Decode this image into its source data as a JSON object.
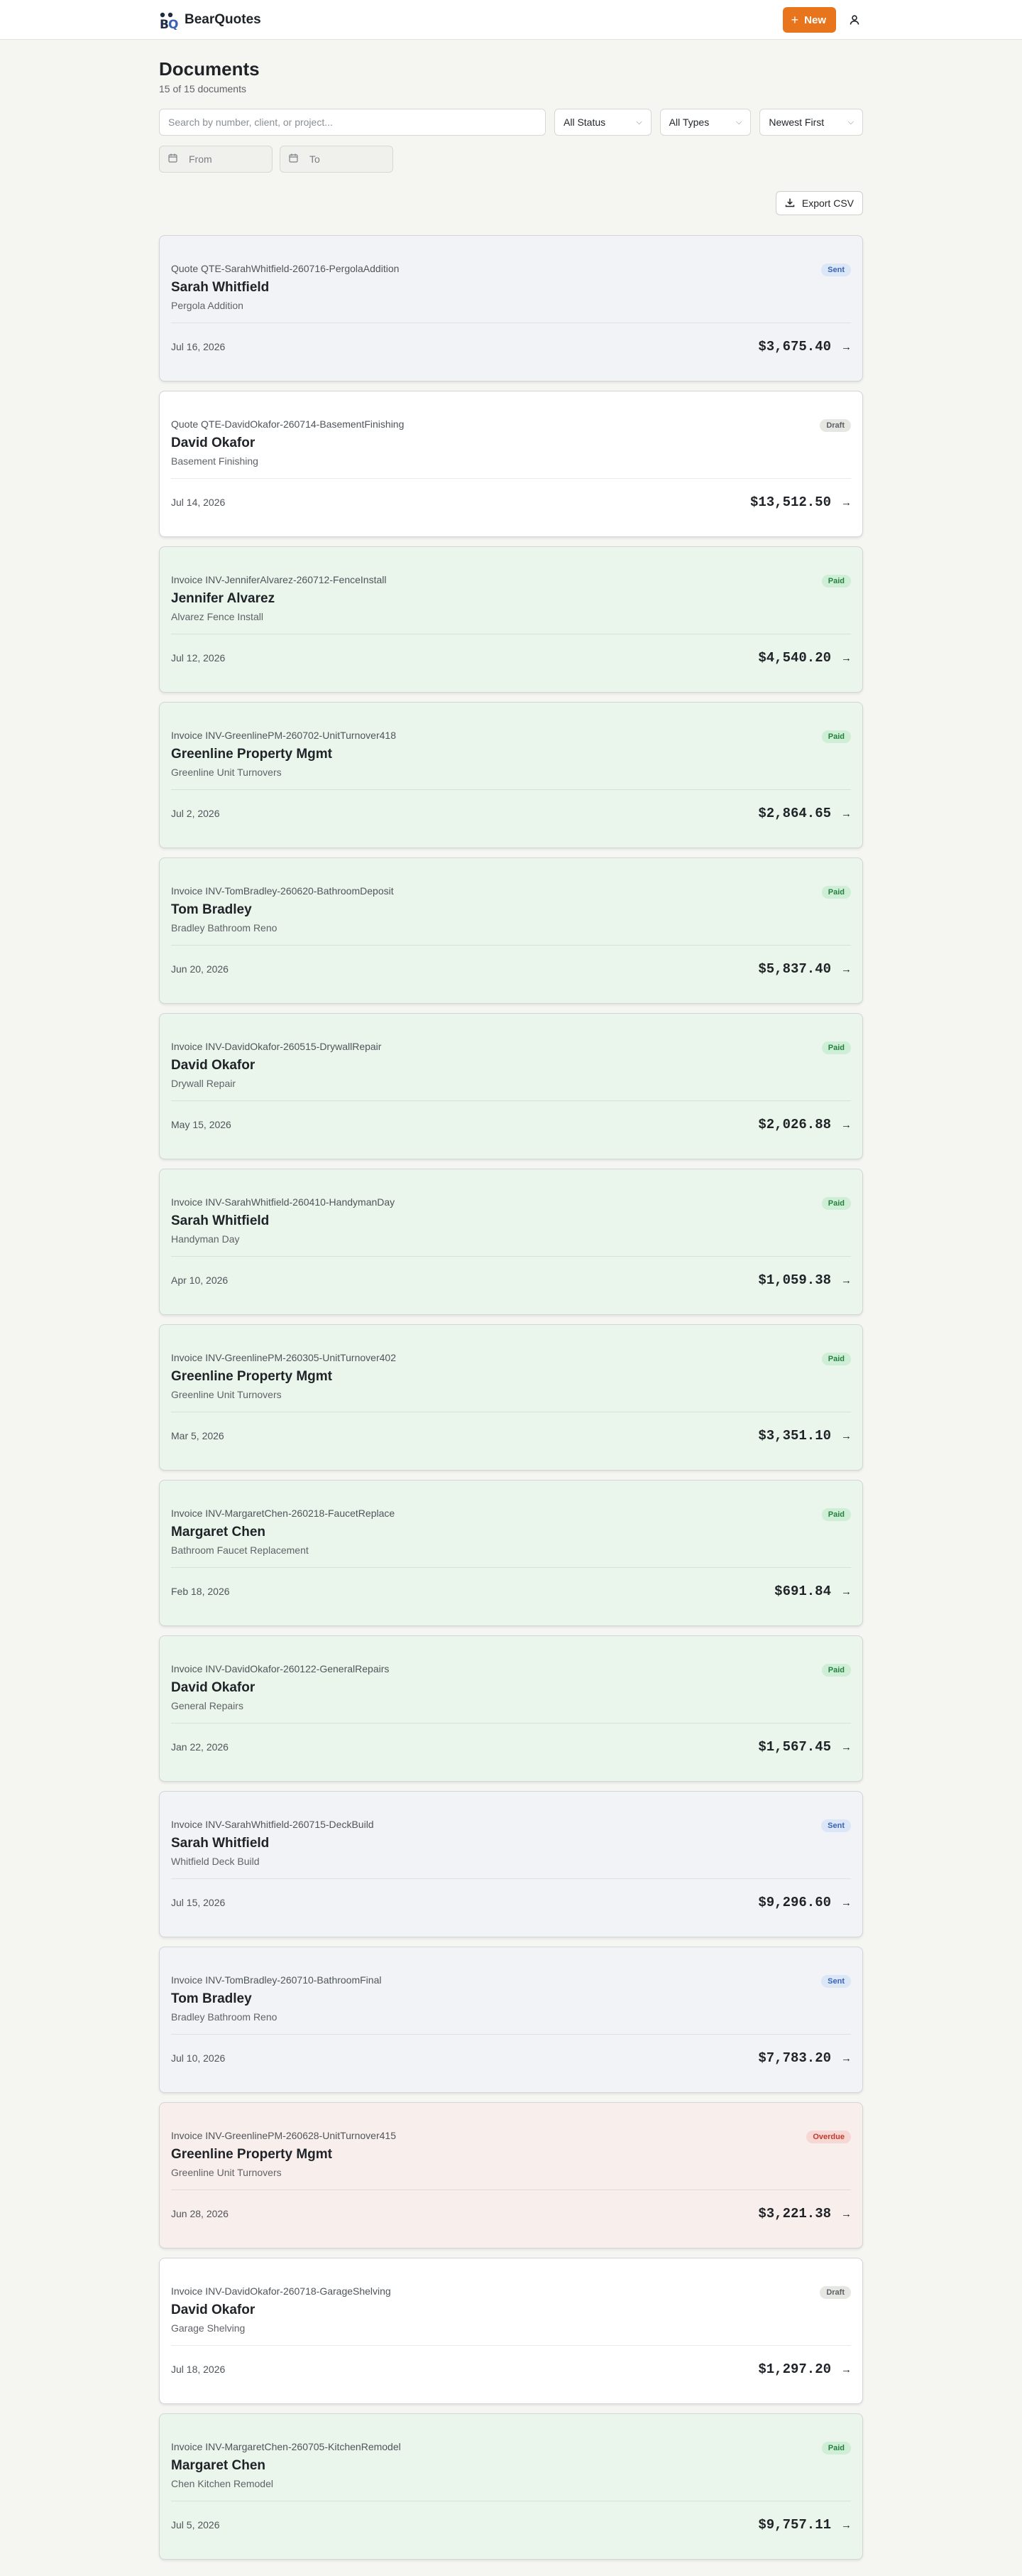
{
  "header": {
    "brand_name": "BearQuotes",
    "new_button_label": "New"
  },
  "page": {
    "title": "Documents",
    "subtitle": "15 of 15 documents"
  },
  "filters": {
    "search_placeholder": "Search by number, client, or project...",
    "status_selected": "All Status",
    "type_selected": "All Types",
    "sort_selected": "Newest First",
    "from_placeholder": "From",
    "to_placeholder": "To",
    "export_label": "Export CSV"
  },
  "status_colors": {
    "sent": "#3b63b5",
    "draft": "#5d6166",
    "paid": "#25803f",
    "overdue": "#c0392b",
    "accent": "#e8741c"
  },
  "documents": [
    {
      "number": "Quote QTE-SarahWhitfield-260716-PergolaAddition",
      "status": "Sent",
      "client": "Sarah Whitfield",
      "project": "Pergola Addition",
      "date": "Jul 16, 2026",
      "amount": "$3,675.40"
    },
    {
      "number": "Quote QTE-DavidOkafor-260714-BasementFinishing",
      "status": "Draft",
      "client": "David Okafor",
      "project": "Basement Finishing",
      "date": "Jul 14, 2026",
      "amount": "$13,512.50"
    },
    {
      "number": "Invoice INV-JenniferAlvarez-260712-FenceInstall",
      "status": "Paid",
      "client": "Jennifer Alvarez",
      "project": "Alvarez Fence Install",
      "date": "Jul 12, 2026",
      "amount": "$4,540.20"
    },
    {
      "number": "Invoice INV-GreenlinePM-260702-UnitTurnover418",
      "status": "Paid",
      "client": "Greenline Property Mgmt",
      "project": "Greenline Unit Turnovers",
      "date": "Jul 2, 2026",
      "amount": "$2,864.65"
    },
    {
      "number": "Invoice INV-TomBradley-260620-BathroomDeposit",
      "status": "Paid",
      "client": "Tom Bradley",
      "project": "Bradley Bathroom Reno",
      "date": "Jun 20, 2026",
      "amount": "$5,837.40"
    },
    {
      "number": "Invoice INV-DavidOkafor-260515-DrywallRepair",
      "status": "Paid",
      "client": "David Okafor",
      "project": "Drywall Repair",
      "date": "May 15, 2026",
      "amount": "$2,026.88"
    },
    {
      "number": "Invoice INV-SarahWhitfield-260410-HandymanDay",
      "status": "Paid",
      "client": "Sarah Whitfield",
      "project": "Handyman Day",
      "date": "Apr 10, 2026",
      "amount": "$1,059.38"
    },
    {
      "number": "Invoice INV-GreenlinePM-260305-UnitTurnover402",
      "status": "Paid",
      "client": "Greenline Property Mgmt",
      "project": "Greenline Unit Turnovers",
      "date": "Mar 5, 2026",
      "amount": "$3,351.10"
    },
    {
      "number": "Invoice INV-MargaretChen-260218-FaucetReplace",
      "status": "Paid",
      "client": "Margaret Chen",
      "project": "Bathroom Faucet Replacement",
      "date": "Feb 18, 2026",
      "amount": "$691.84"
    },
    {
      "number": "Invoice INV-DavidOkafor-260122-GeneralRepairs",
      "status": "Paid",
      "client": "David Okafor",
      "project": "General Repairs",
      "date": "Jan 22, 2026",
      "amount": "$1,567.45"
    },
    {
      "number": "Invoice INV-SarahWhitfield-260715-DeckBuild",
      "status": "Sent",
      "client": "Sarah Whitfield",
      "project": "Whitfield Deck Build",
      "date": "Jul 15, 2026",
      "amount": "$9,296.60"
    },
    {
      "number": "Invoice INV-TomBradley-260710-BathroomFinal",
      "status": "Sent",
      "client": "Tom Bradley",
      "project": "Bradley Bathroom Reno",
      "date": "Jul 10, 2026",
      "amount": "$7,783.20"
    },
    {
      "number": "Invoice INV-GreenlinePM-260628-UnitTurnover415",
      "status": "Overdue",
      "client": "Greenline Property Mgmt",
      "project": "Greenline Unit Turnovers",
      "date": "Jun 28, 2026",
      "amount": "$3,221.38"
    },
    {
      "number": "Invoice INV-DavidOkafor-260718-GarageShelving",
      "status": "Draft",
      "client": "David Okafor",
      "project": "Garage Shelving",
      "date": "Jul 18, 2026",
      "amount": "$1,297.20"
    },
    {
      "number": "Invoice INV-MargaretChen-260705-KitchenRemodel",
      "status": "Paid",
      "client": "Margaret Chen",
      "project": "Chen Kitchen Remodel",
      "date": "Jul 5, 2026",
      "amount": "$9,757.11"
    }
  ]
}
